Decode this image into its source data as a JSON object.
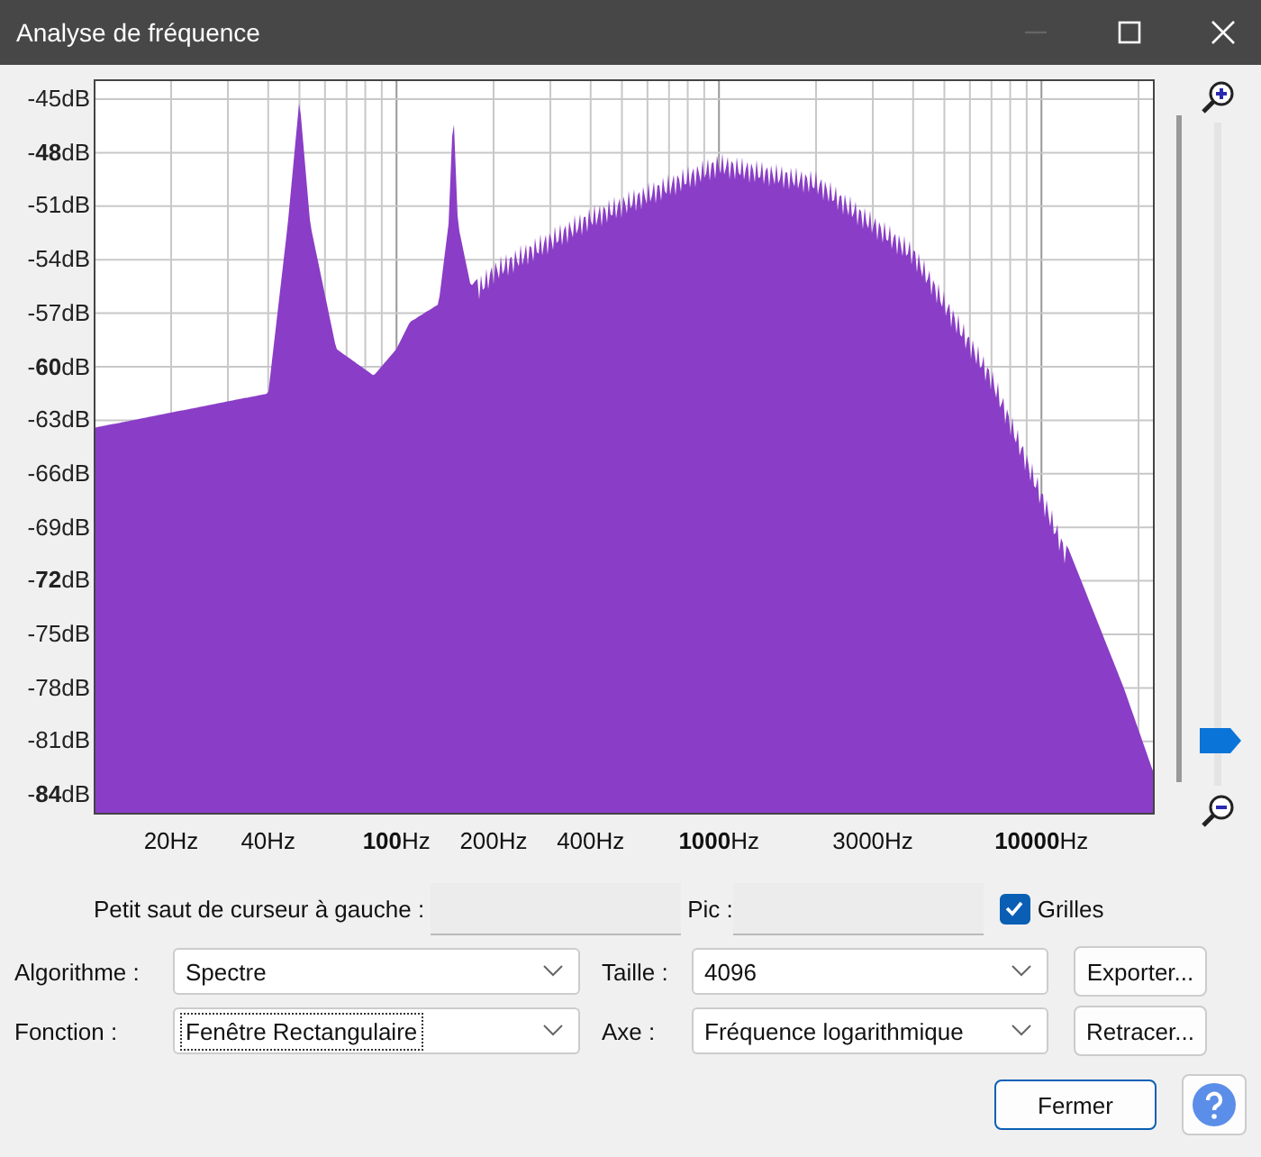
{
  "window": {
    "title": "Analyse de fréquence"
  },
  "plot": {
    "y_labels": [
      "-45dB",
      "-**48**dB",
      "-51dB",
      "-54dB",
      "-57dB",
      "-**60**dB",
      "-63dB",
      "-66dB",
      "-69dB",
      "-**72**dB",
      "-75dB",
      "-78dB",
      "-81dB",
      "-**84**dB"
    ],
    "x_labels": [
      "20Hz",
      "40Hz",
      "**100**Hz",
      "200Hz",
      "400Hz",
      "**1000**Hz",
      "3000Hz",
      "**10000**Hz"
    ]
  },
  "zoom_slider": {
    "level": 0.05
  },
  "cursor": {
    "label": "Petit saut de curseur à gauche :",
    "peak_label": "Pic :"
  },
  "grids_checkbox": {
    "label": "Grilles",
    "checked": true
  },
  "fields": [
    {
      "label": "Algorithme :",
      "value": "Spectre",
      "focused": false
    },
    {
      "label": "Taille :",
      "value": "4096",
      "focused": false
    },
    {
      "label": "Fonction :",
      "value": "Fenêtre Rectangulaire",
      "focused": true
    },
    {
      "label": "Axe :",
      "value": "Fréquence logarithmique",
      "focused": false
    }
  ],
  "side_buttons": [
    "Exporter...",
    "Retracer..."
  ],
  "close_button": "Fermer"
}
